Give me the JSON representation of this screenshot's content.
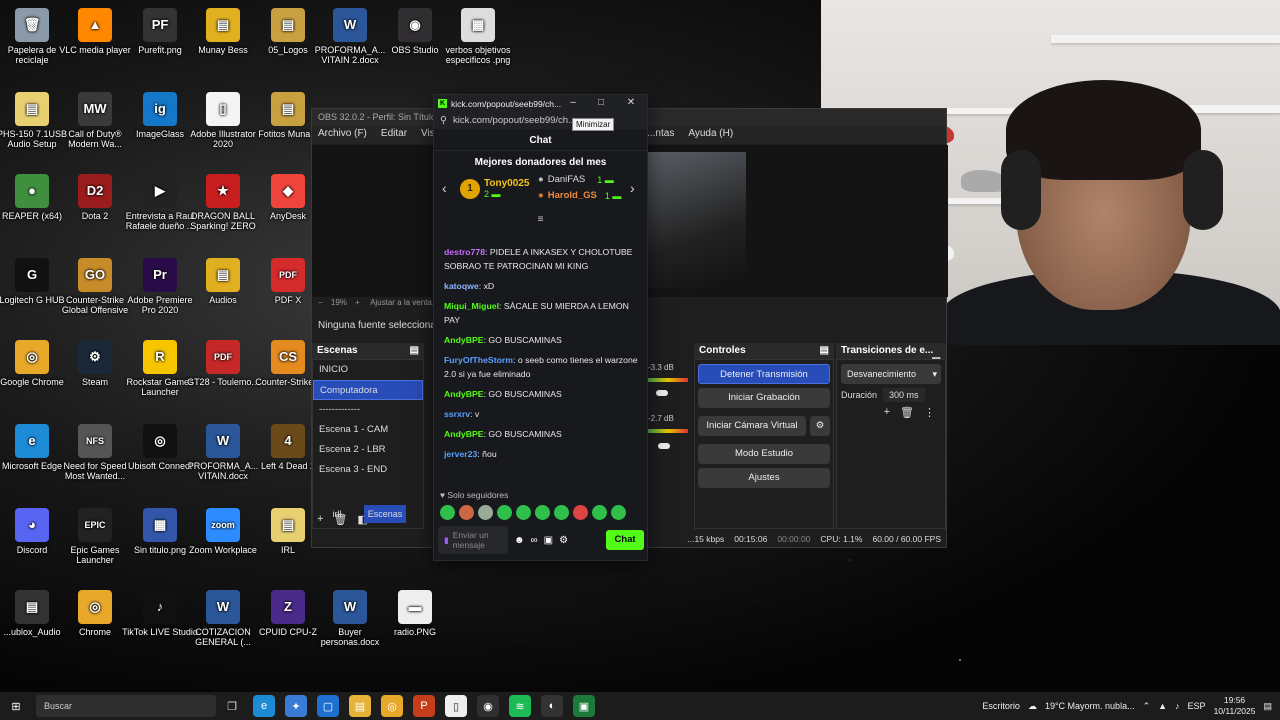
{
  "desktop_icons": [
    {
      "label": "Papelera de reciclaje",
      "color": "#8a9aa8",
      "glyph": "🗑"
    },
    {
      "label": "VLC media player",
      "color": "#ff8800",
      "glyph": "▲"
    },
    {
      "label": "Purefit.png",
      "color": "#333",
      "glyph": "PF"
    },
    {
      "label": "Munay Bess",
      "color": "#e0b020",
      "glyph": "▤"
    },
    {
      "label": "05_Logos",
      "color": "#c9a040",
      "glyph": "▤"
    },
    {
      "label": "PROFORMA_A... VITAIN 2.docx",
      "color": "#2b579a",
      "glyph": "W"
    },
    {
      "label": "OBS Studio",
      "color": "#302e31",
      "glyph": "◉"
    },
    {
      "label": "verbos objetivos especificos .png",
      "color": "#ddd",
      "glyph": "▦"
    },
    {
      "label": "PHS-150 7.1USB Audio Setup",
      "color": "#e8d070",
      "glyph": "▤"
    },
    {
      "label": "Call of Duty® Modern Wa...",
      "color": "#3a3a3a",
      "glyph": "MW"
    },
    {
      "label": "ImageGlass",
      "color": "#1477c8",
      "glyph": "ig"
    },
    {
      "label": "Adobe Illustrator 2020",
      "color": "#f4f4f4",
      "glyph": "▯"
    },
    {
      "label": "Fotitos Muna...",
      "color": "#c9a040",
      "glyph": "▤"
    },
    {
      "label": "REAPER (x64)",
      "color": "#3f8f3f",
      "glyph": "●"
    },
    {
      "label": "Dota 2",
      "color": "#9b1c1c",
      "glyph": "D2"
    },
    {
      "label": "Entrevista a Raul Rafaele dueño ...",
      "color": "#222",
      "glyph": "▶"
    },
    {
      "label": "DRAGON BALL Sparking! ZERO",
      "color": "#c81e1e",
      "glyph": "★"
    },
    {
      "label": "AnyDesk",
      "color": "#ef443b",
      "glyph": "◆"
    },
    {
      "label": "Logitech G HUB",
      "color": "#111",
      "glyph": "G"
    },
    {
      "label": "Counter-Strike Global Offensive",
      "color": "#c78b2a",
      "glyph": "GO"
    },
    {
      "label": "Adobe Premiere Pro 2020",
      "color": "#2a0b4a",
      "glyph": "Pr"
    },
    {
      "label": "Audios",
      "color": "#e0b020",
      "glyph": "▤"
    },
    {
      "label": "PDF X",
      "color": "#d52b2b",
      "glyph": "PDF"
    },
    {
      "label": "Google Chrome",
      "color": "#e8a92b",
      "glyph": "◎"
    },
    {
      "label": "Steam",
      "color": "#1b2838",
      "glyph": "⚙"
    },
    {
      "label": "Rockstar Games Launcher",
      "color": "#f7c400",
      "glyph": "R"
    },
    {
      "label": "GT28 - Toulemo...",
      "color": "#c62828",
      "glyph": "PDF"
    },
    {
      "label": "Counter-Strike 2",
      "color": "#e58a1f",
      "glyph": "CS"
    },
    {
      "label": "Microsoft Edge",
      "color": "#1d8ad6",
      "glyph": "e"
    },
    {
      "label": "Need for Speed Most Wanted...",
      "color": "#555",
      "glyph": "NFS"
    },
    {
      "label": "Ubisoft Connect",
      "color": "#111",
      "glyph": "◎"
    },
    {
      "label": "PROFORMA_A... VITAIN.docx",
      "color": "#2b579a",
      "glyph": "W"
    },
    {
      "label": "Left 4 Dead 2",
      "color": "#6b4a1a",
      "glyph": "4"
    },
    {
      "label": "Discord",
      "color": "#5865f2",
      "glyph": "◕"
    },
    {
      "label": "Epic Games Launcher",
      "color": "#222",
      "glyph": "EPIC"
    },
    {
      "label": "Sin titulo.png",
      "color": "#3355aa",
      "glyph": "▦"
    },
    {
      "label": "Zoom Workplace",
      "color": "#2d8cff",
      "glyph": "zoom"
    },
    {
      "label": "IRL",
      "color": "#e8d070",
      "glyph": "▤"
    },
    {
      "label": "...ublox_Audio",
      "color": "#333",
      "glyph": "▤"
    },
    {
      "label": "Chrome",
      "color": "#e8a92b",
      "glyph": "◎"
    },
    {
      "label": "TikTok LIVE Studio",
      "color": "#111",
      "glyph": "♪"
    },
    {
      "label": "COTIZACION GENERAL (...",
      "color": "#2b579a",
      "glyph": "W"
    },
    {
      "label": "CPUID CPU-Z",
      "color": "#4a2a8a",
      "glyph": "Z"
    },
    {
      "label": "Buyer personas.docx",
      "color": "#2b579a",
      "glyph": "W"
    },
    {
      "label": "radio.PNG",
      "color": "#eee",
      "glyph": "▬"
    }
  ],
  "obs": {
    "title": "OBS 32.0.2 - Perfil: Sin Título - ...",
    "menu": [
      "Archivo (F)",
      "Editar",
      "Vista"
    ],
    "menu_right": [
      "...ntas",
      "Ayuda (H)"
    ],
    "zoom": "19%",
    "zoom_hint": "Ajustar a la venta...",
    "no_source": "Ninguna fuente seleccionada",
    "scenes_header": "Escenas",
    "scenes": [
      "INICIO",
      "Computadora",
      "-------------",
      "Escena 1 - CAM",
      "Escena 2 - LBR",
      "Escena 3 - END"
    ],
    "selected_scene": 1,
    "tabs": [
      "irll",
      "Escenas"
    ],
    "mixer": {
      "db1": "-3.3 dB",
      "db2": "-2.7 dB"
    },
    "controls_header": "Controles",
    "controls": [
      "Detener Transmisión",
      "Iniciar Grabación",
      "Iniciar Cámara Virtual",
      "Modo Estudio",
      "Ajustes"
    ],
    "transitions_header": "Transiciones de e...",
    "transition": "Desvanecimiento",
    "duration_label": "Duración",
    "duration_value": "300 ms",
    "status": {
      "kbps": "...15 kbps",
      "live": "00:15:06",
      "rec": "00:00:00",
      "cpu": "CPU: 1.1%",
      "fps": "60.00 / 60.00 FPS"
    }
  },
  "kick": {
    "window_title": "kick.com/popout/seeb99/ch...",
    "url": "kick.com/popout/seeb99/ch...",
    "tooltip": "Minimizar",
    "chat_header": "Chat",
    "donors_title": "Mejores donadores del mes",
    "donors": [
      {
        "rank": "1",
        "name": "Tony0025",
        "amount": "2"
      },
      {
        "name": "DaniFAS",
        "amount": "1"
      },
      {
        "name": "Harold_GS",
        "amount": "1"
      }
    ],
    "messages": [
      {
        "user": "destro778",
        "color": "#c86bff",
        "text": "PIDELE A INKASEX Y CHOLOTUBE SOBRAO TE PATROCINAN MI KING"
      },
      {
        "user": "katoqwe",
        "color": "#8ab4ff",
        "text": "xD"
      },
      {
        "user": "Miqui_Miguel",
        "color": "#53fc18",
        "text": "SÁCALE SU MIERDA A LEMON PAY"
      },
      {
        "user": "AndyBPE",
        "color": "#53fc18",
        "text": "GO BUSCAMINAS"
      },
      {
        "user": "FuryOfTheStorm",
        "color": "#5aa0ff",
        "text": "o seeb como tienes el warzone 2.0 si ya fue eliminado"
      },
      {
        "user": "AndyBPE",
        "color": "#53fc18",
        "text": "GO BUSCAMINAS"
      },
      {
        "user": "ssrxrv",
        "color": "#5aa0ff",
        "text": "v"
      },
      {
        "user": "AndyBPE",
        "color": "#53fc18",
        "text": "GO BUSCAMINAS"
      },
      {
        "user": "jerver23",
        "color": "#5aa0ff",
        "text": "ñou"
      }
    ],
    "followers_only": "Solo seguidores",
    "input_placeholder": "Enviar un mensaje",
    "send_label": "Chat"
  },
  "taskbar": {
    "search": "Buscar",
    "desktop_label": "Escritorio",
    "weather": "19°C  Mayorm. nubla...",
    "lang": "ESP",
    "time": "19:56",
    "date": "10/11/2025"
  }
}
